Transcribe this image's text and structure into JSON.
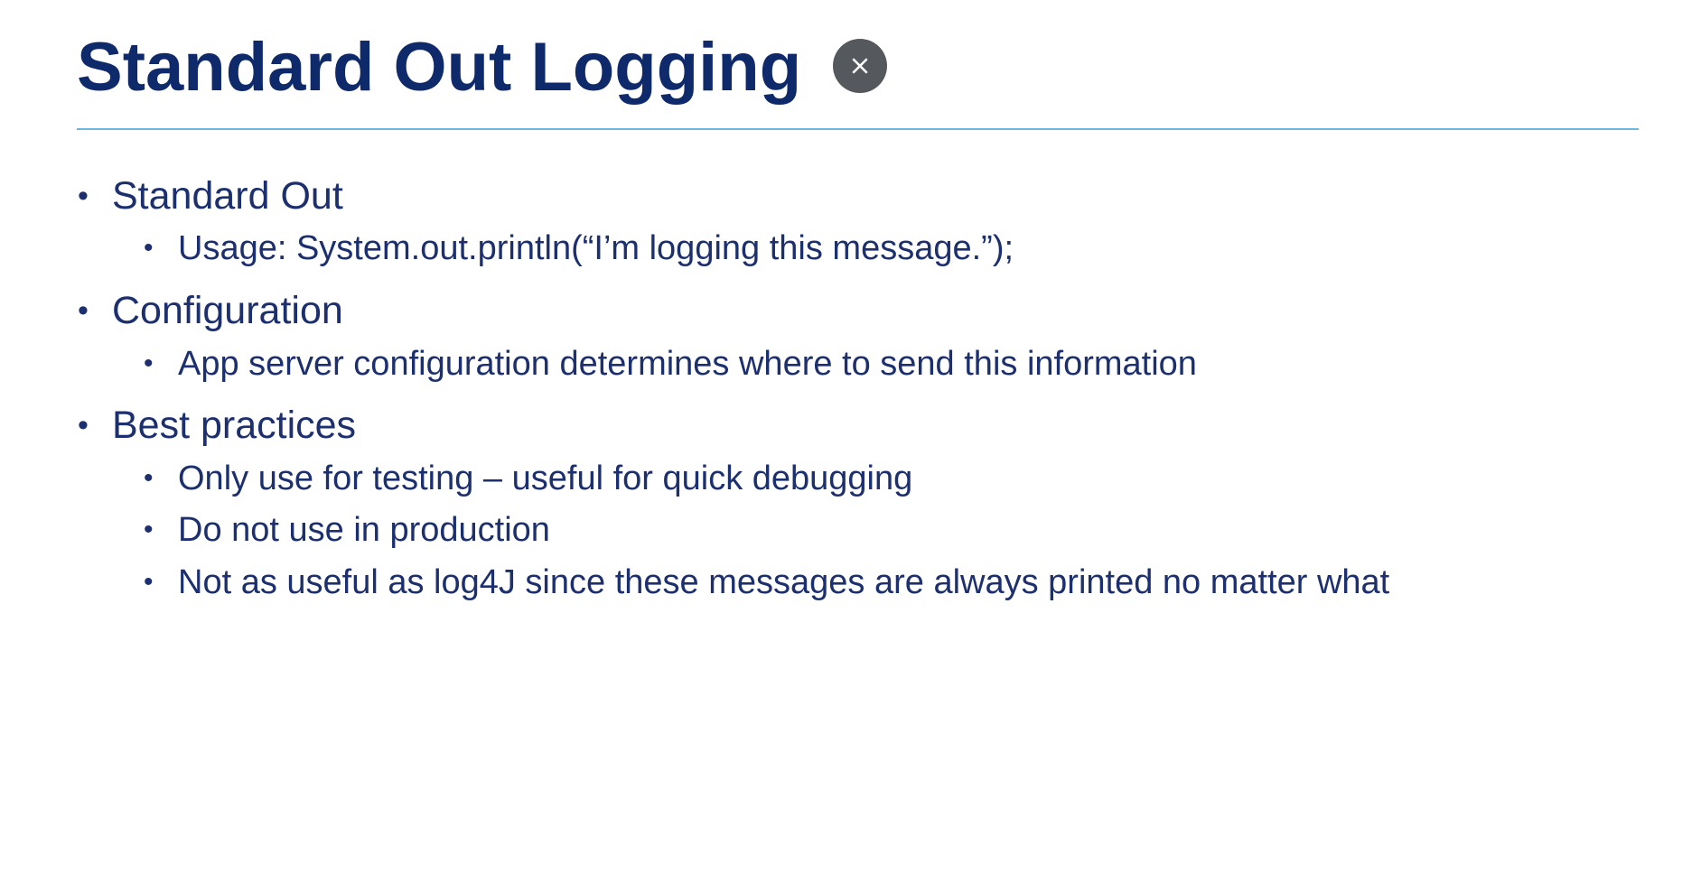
{
  "slide": {
    "title": "Standard Out Logging",
    "close_icon": "close-icon",
    "accent_color": "#0f2a6b",
    "rule_color": "#6ab8e0",
    "bullets": [
      {
        "text": "Standard Out",
        "sub": [
          "Usage: System.out.println(“I’m logging this message.”);"
        ]
      },
      {
        "text": "Configuration",
        "sub": [
          "App server configuration determines where to send this information"
        ]
      },
      {
        "text": "Best practices",
        "sub": [
          "Only use for testing – useful for quick debugging",
          "Do not use in production",
          "Not as useful as log4J since these messages are always printed no matter what"
        ]
      }
    ]
  }
}
